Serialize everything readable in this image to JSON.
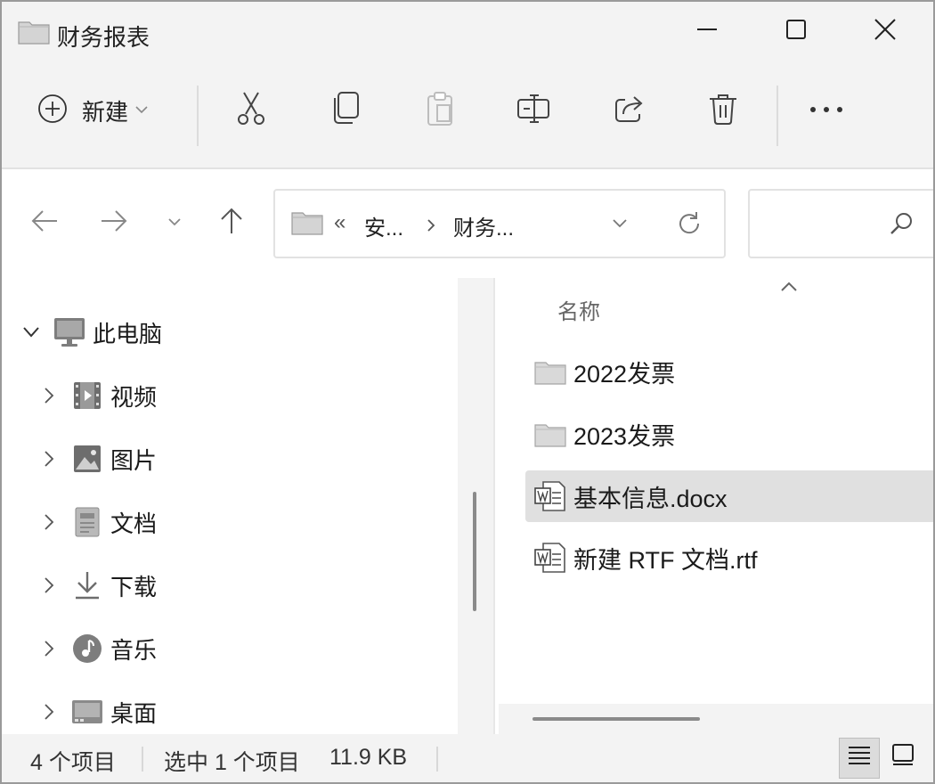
{
  "window": {
    "title": "财务报表",
    "controls": {
      "minimize_icon": "minimize-icon",
      "maximize_icon": "maximize-icon",
      "close_icon": "close-icon"
    }
  },
  "commandbar": {
    "new_label": "新建",
    "actions": [
      "cut-icon",
      "copy-icon",
      "paste-icon",
      "rename-icon",
      "share-icon",
      "delete-icon",
      "more-icon"
    ]
  },
  "address": {
    "overflow": "«",
    "crumbs": [
      "安...",
      "财务..."
    ],
    "search_placeholder": ""
  },
  "nav": {
    "root_label": "此电脑",
    "items": [
      {
        "label": "视频",
        "icon": "videos-icon"
      },
      {
        "label": "图片",
        "icon": "pictures-icon"
      },
      {
        "label": "文档",
        "icon": "documents-icon"
      },
      {
        "label": "下载",
        "icon": "downloads-icon"
      },
      {
        "label": "音乐",
        "icon": "music-icon"
      },
      {
        "label": "桌面",
        "icon": "desktop-icon"
      }
    ]
  },
  "filelist": {
    "column_name": "名称",
    "files": [
      {
        "name": "2022发票",
        "type": "folder",
        "selected": false
      },
      {
        "name": "2023发票",
        "type": "folder",
        "selected": false
      },
      {
        "name": "基本信息.docx",
        "type": "word",
        "selected": true
      },
      {
        "name": "新建 RTF 文档.rtf",
        "type": "word",
        "selected": false
      }
    ]
  },
  "status": {
    "item_count": "4 个项目",
    "selection": "选中 1 个项目",
    "size": "11.9 KB"
  },
  "colors": {
    "selection": "#e0e0e0",
    "chrome": "#f3f3f3",
    "folder": "#d9d9d9"
  }
}
